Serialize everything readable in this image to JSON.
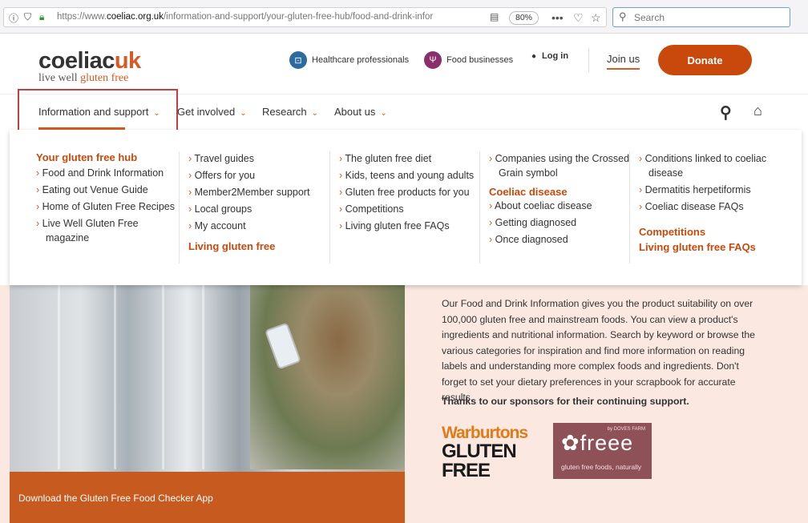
{
  "browser": {
    "url_prefix": "https://www.",
    "url_domain": "coeliac.org.uk",
    "url_path": "/information-and-support/your-gluten-free-hub/food-and-drink-infor",
    "zoom": "80%",
    "search_placeholder": "Search"
  },
  "header": {
    "logo_word1": "coeliac",
    "logo_word2": "uk",
    "logo_tag1": "live well",
    "logo_tag2": "gluten free",
    "healthcare": "Healthcare professionals",
    "food_businesses": "Food businesses",
    "login": "Log in",
    "join": "Join us",
    "donate": "Donate"
  },
  "nav": {
    "items": [
      "Information and support",
      "Get involved",
      "Research",
      "About us"
    ]
  },
  "mega": {
    "col1": {
      "head": "Your gluten free hub",
      "links": [
        "Food and Drink Information",
        "Eating out Venue Guide",
        "Home of Gluten Free Recipes",
        "Live Well Gluten Free magazine"
      ]
    },
    "col2": {
      "links": [
        "Travel guides",
        "Offers for you",
        "Member2Member support",
        "Local groups",
        "My account"
      ],
      "head2": "Living gluten free"
    },
    "col3": {
      "links": [
        "The gluten free diet",
        "Kids, teens and young adults",
        "Gluten free products for you",
        "Competitions",
        "Living gluten free FAQs"
      ]
    },
    "col4": {
      "links": [
        "Companies using the Crossed Grain symbol"
      ],
      "head2": "Coeliac disease",
      "links2": [
        "About coeliac disease",
        "Getting diagnosed",
        "Once diagnosed"
      ]
    },
    "col5": {
      "links": [
        "Conditions linked to coeliac disease",
        "Dermatitis herpetiformis",
        "Coeliac disease FAQs"
      ],
      "head2": "Competitions",
      "head3": "Living gluten free FAQs"
    }
  },
  "hero": {
    "download": "Download the Gluten Free Food Checker App",
    "copy": "Our Food and Drink Information gives you the product suitability on over 100,000 gluten free and mainstream foods. You can view a product's ingredients and nutritional information. Search by keyword or browse the various categories for inspiration and find more information on reading labels and understanding more complex foods and ingredients. Don't forget to set your dietary preferences in your scrapbook for accurate results.",
    "thanks": "Thanks to our sponsors for their continuing support.",
    "sponsor1_line1": "Warburtons",
    "sponsor1_line2": "GLUTEN FREE",
    "sponsor2_brand": "freee",
    "sponsor2_by": "by DOVES FARM",
    "sponsor2_slogan": "gluten free foods, naturally"
  },
  "colors": {
    "accent": "#d95a22",
    "donate": "#c9490c",
    "highlight_box": "#c43f3f",
    "hero_bg": "#fbe9e1",
    "freee_bg": "#8e5158"
  }
}
